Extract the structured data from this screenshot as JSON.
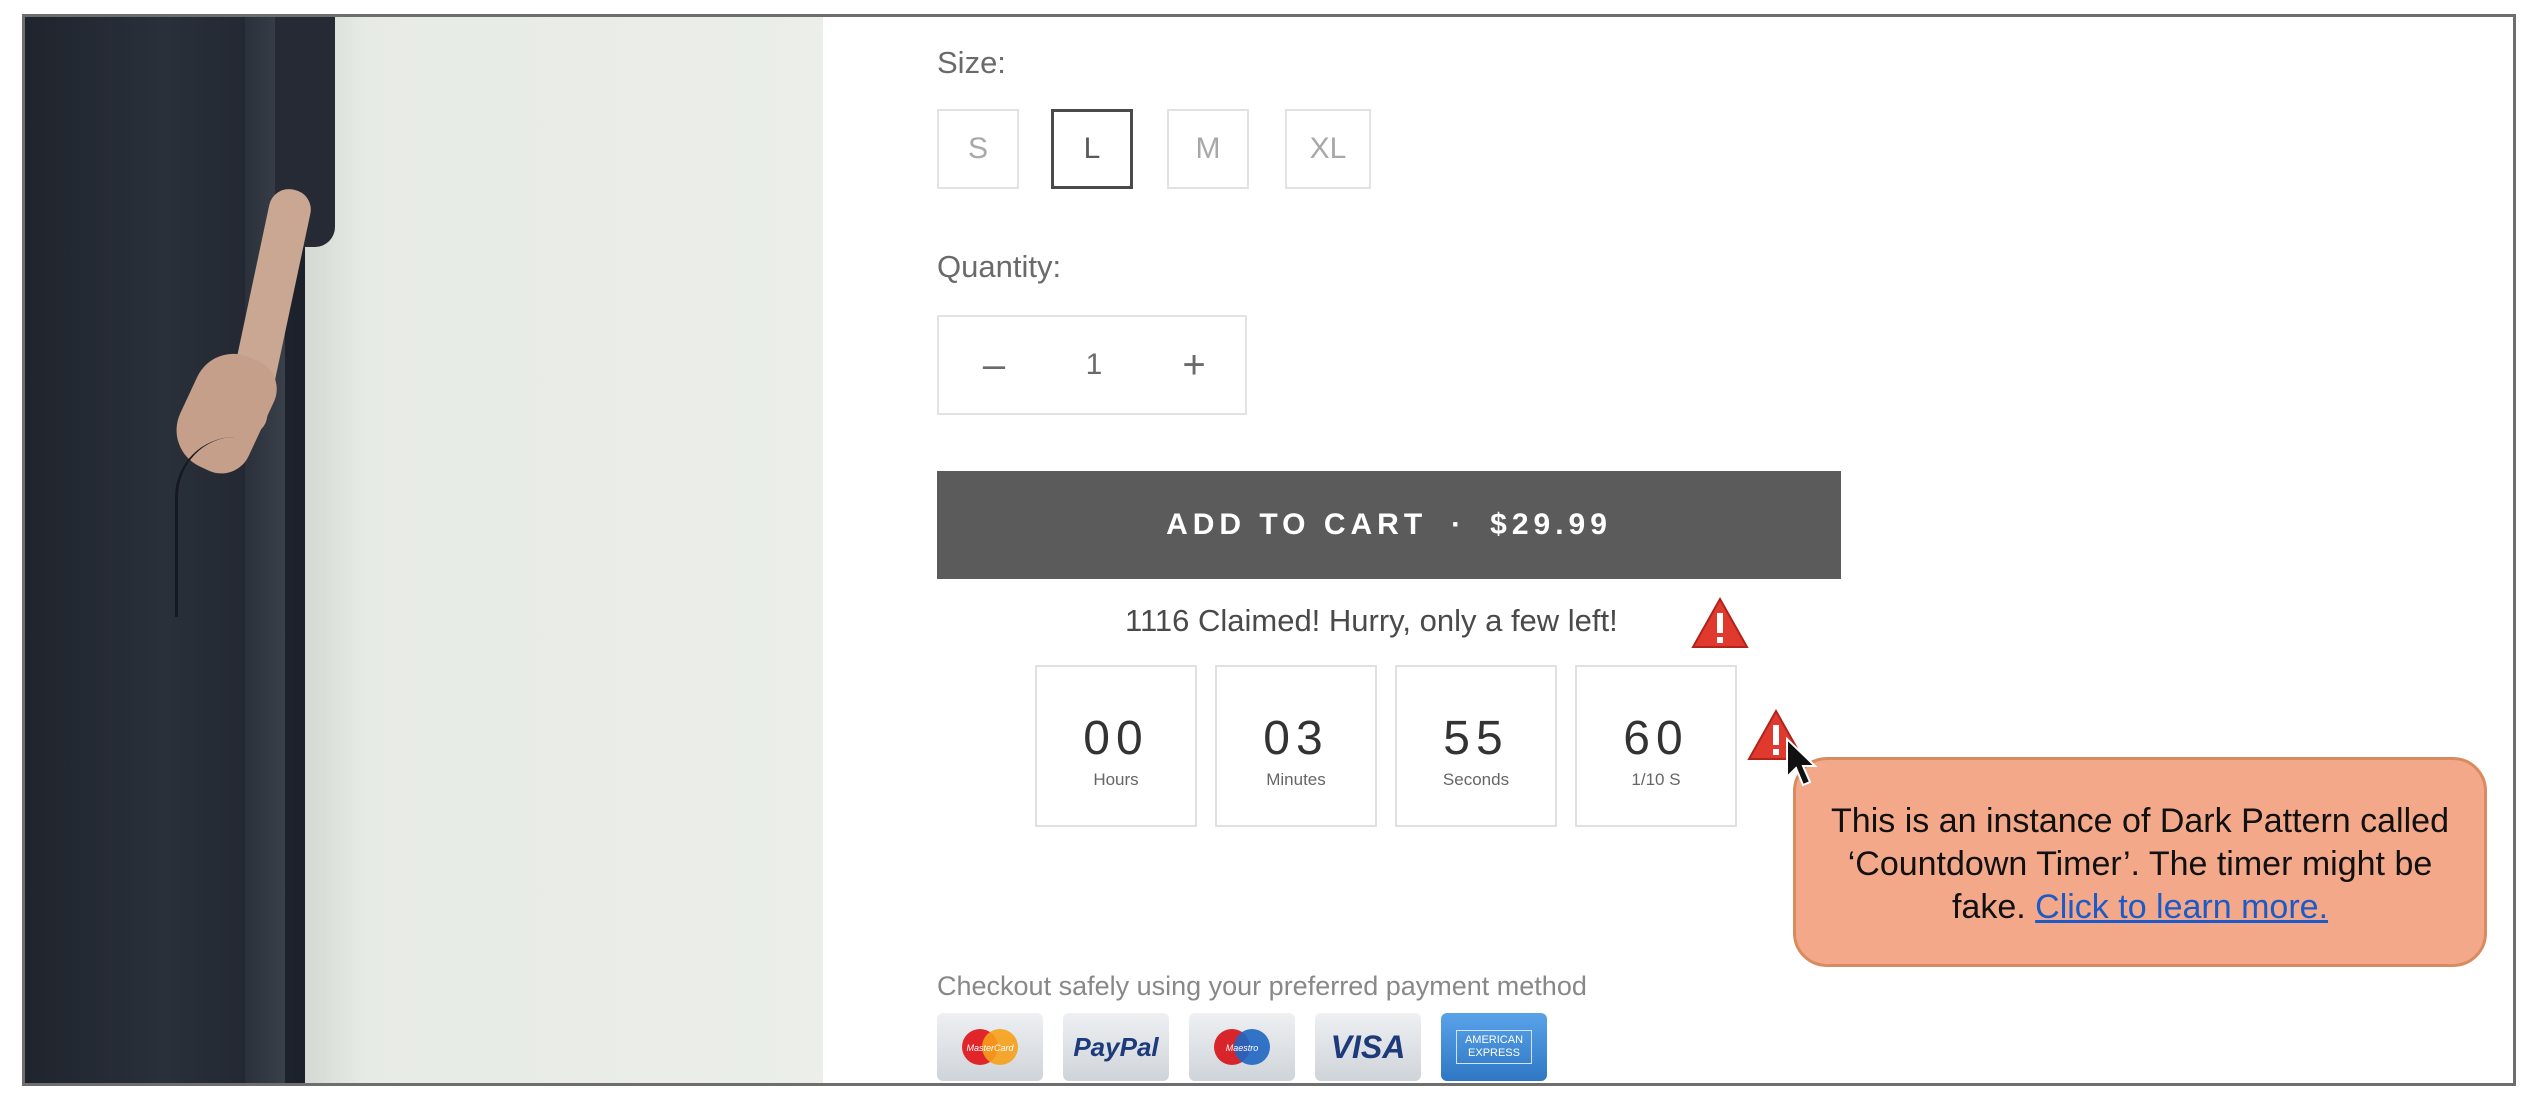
{
  "size": {
    "label": "Size:",
    "options": [
      "S",
      "L",
      "M",
      "XL"
    ],
    "selected": "L"
  },
  "quantity": {
    "label": "Quantity:",
    "minus": "–",
    "value": "1",
    "plus": "+"
  },
  "cart": {
    "label": "ADD TO CART",
    "separator": "·",
    "price": "$29.99"
  },
  "claimed": {
    "text": "1116  Claimed! Hurry, only a few left!"
  },
  "timer": [
    {
      "value": "00",
      "unit": "Hours"
    },
    {
      "value": "03",
      "unit": "Minutes"
    },
    {
      "value": "55",
      "unit": "Seconds"
    },
    {
      "value": "60",
      "unit": "1/10 S"
    }
  ],
  "callout": {
    "text": "This is an instance of Dark Pattern called ‘Countdown Timer’. The timer might be fake.",
    "link": "Click to learn more."
  },
  "payment": {
    "note": "Checkout safely using your preferred payment method",
    "methods": [
      {
        "name": "MasterCard",
        "icon": "mastercard-icon"
      },
      {
        "name": "PayPal",
        "icon": "paypal-icon"
      },
      {
        "name": "Maestro",
        "icon": "maestro-icon"
      },
      {
        "name": "VISA",
        "icon": "visa-icon"
      },
      {
        "name": "AMERICAN EXPRESS",
        "icon": "amex-icon"
      }
    ]
  },
  "colors": {
    "cart_button": "#5b5b5b",
    "callout_bg": "#f2a889",
    "warning": "#e03a2f",
    "link": "#1d5ac9"
  }
}
